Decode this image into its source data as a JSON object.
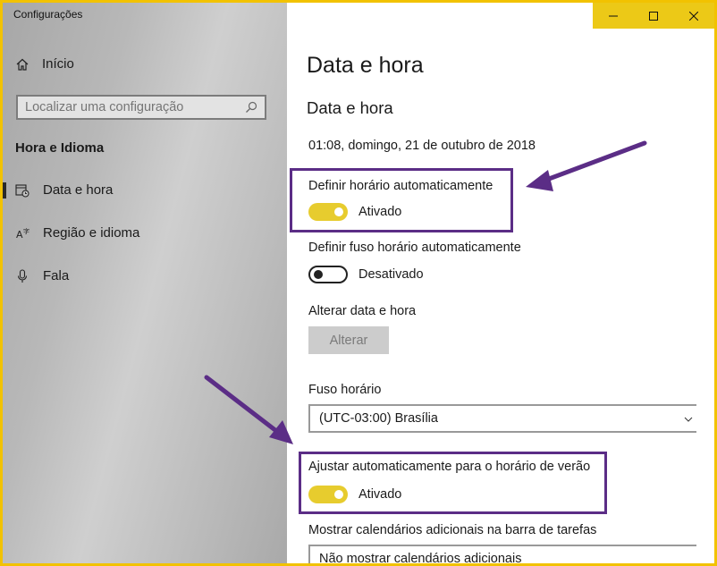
{
  "app": {
    "title": "Configurações"
  },
  "sidebar": {
    "home_label": "Início",
    "search_placeholder": "Localizar uma configuração",
    "section_heading": "Hora e Idioma",
    "items": [
      {
        "label": "Data e hora",
        "icon": "calendar-clock-icon",
        "selected": true
      },
      {
        "label": "Região e idioma",
        "icon": "language-icon",
        "selected": false
      },
      {
        "label": "Fala",
        "icon": "microphone-icon",
        "selected": false
      }
    ]
  },
  "window_controls": {
    "minimize": "minimize-icon",
    "maximize": "maximize-icon",
    "close": "close-icon",
    "accent": "#ecc917"
  },
  "main": {
    "page_title": "Data e hora",
    "section_title": "Data e hora",
    "current_datetime": "01:08, domingo, 21 de outubro de 2018",
    "auto_time": {
      "label": "Definir horário automaticamente",
      "state": "Ativado",
      "on": true
    },
    "auto_timezone": {
      "label": "Definir fuso horário automaticamente",
      "state": "Desativado",
      "on": false
    },
    "change_datetime": {
      "label": "Alterar data e hora",
      "button": "Alterar"
    },
    "timezone": {
      "label": "Fuso horário",
      "value": "(UTC-03:00) Brasília"
    },
    "dst": {
      "label": "Ajustar automaticamente para o horário de verão",
      "state": "Ativado",
      "on": true
    },
    "extra_calendars": {
      "label": "Mostrar calendários adicionais na barra de tarefas",
      "value": "Não mostrar calendários adicionais"
    }
  },
  "annotation_color": "#5b2d86",
  "toggle_on_color": "#e7cc2e"
}
